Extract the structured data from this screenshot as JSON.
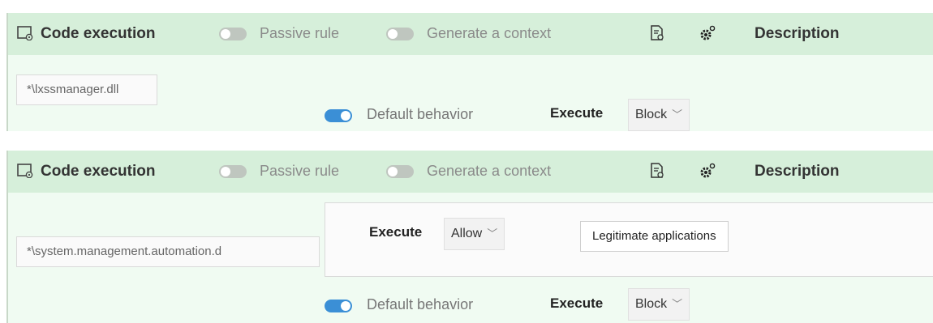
{
  "rules": [
    {
      "type_label": "Code execution",
      "passive_label": "Passive rule",
      "context_label": "Generate a context",
      "description_label": "Description",
      "path": "*\\lxssmanager.dll",
      "default_behavior_label": "Default behavior",
      "execute_label": "Execute",
      "default_action": "Block"
    },
    {
      "type_label": "Code execution",
      "passive_label": "Passive rule",
      "context_label": "Generate a context",
      "description_label": "Description",
      "path": "*\\system.management.automation.d",
      "exception": {
        "execute_label": "Execute",
        "action": "Allow",
        "button_label": "Legitimate applications"
      },
      "default_behavior_label": "Default behavior",
      "execute_label": "Execute",
      "default_action": "Block"
    }
  ],
  "colors": {
    "header_bg": "#d6efda",
    "body_bg": "#f0fbf2",
    "toggle_on": "#3b8fd6",
    "toggle_off": "#bfc6bf"
  }
}
